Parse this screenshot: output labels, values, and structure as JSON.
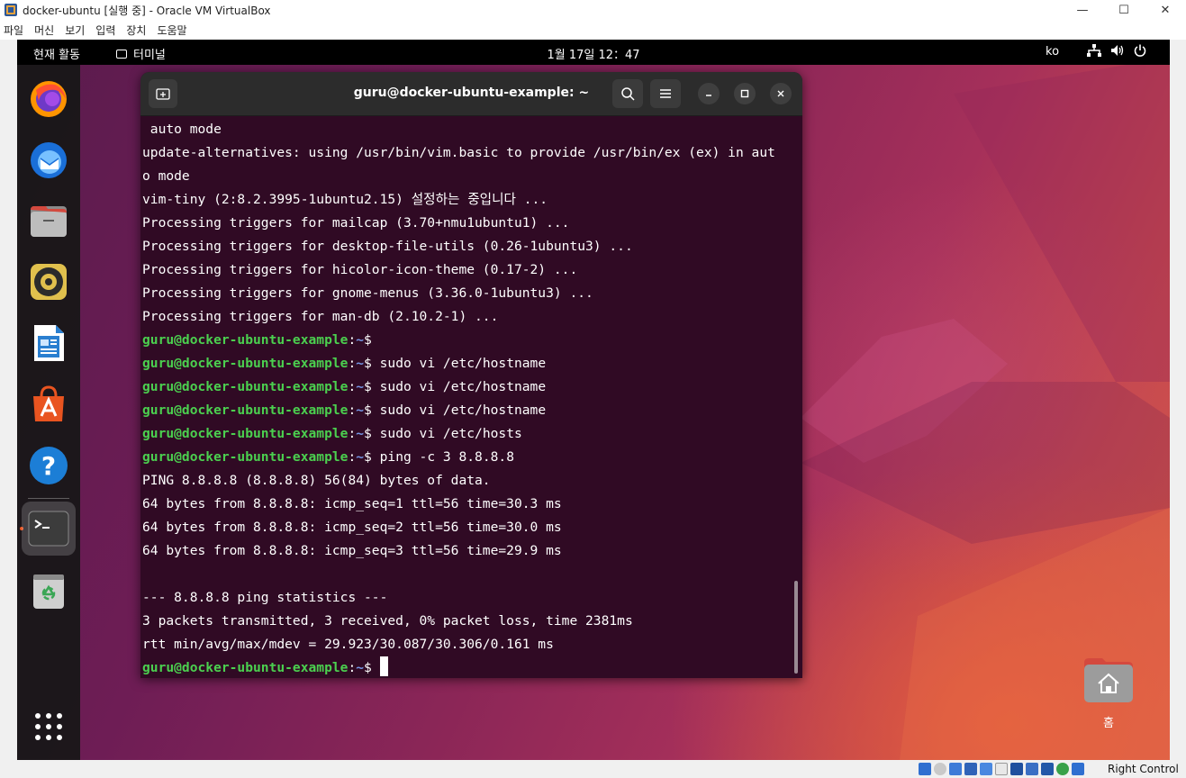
{
  "host": {
    "title": "docker-ubuntu [실행 중] - Oracle VM VirtualBox",
    "controls": [
      "—",
      "☐",
      "✕"
    ],
    "menu": [
      "파일",
      "머신",
      "보기",
      "입력",
      "장치",
      "도움말"
    ],
    "host_key": "Right Control"
  },
  "topbar": {
    "activities": "현재 활동",
    "app_name": "터미널",
    "clock": "1월 17일  12：47",
    "lang": "ko"
  },
  "dock": {
    "items": [
      "firefox-icon",
      "thunderbird-icon",
      "files-icon",
      "rhythmbox-icon",
      "libreoffice-writer-icon",
      "app-center-icon",
      "help-icon",
      "terminal-icon",
      "trash-icon",
      "show-apps-icon"
    ]
  },
  "terminal": {
    "title": "guru@docker-ubuntu-example: ~",
    "prompt_user": "guru@docker-ubuntu-example",
    "prompt_sep": ":",
    "prompt_path": "~",
    "prompt_end": "$ ",
    "lines": [
      " auto mode",
      "update-alternatives: using /usr/bin/vim.basic to provide /usr/bin/ex (ex) in aut",
      "o mode",
      "vim-tiny (2:8.2.3995-1ubuntu2.15) 설정하는 중입니다 ...",
      "Processing triggers for mailcap (3.70+nmu1ubuntu1) ...",
      "Processing triggers for desktop-file-utils (0.26-1ubuntu3) ...",
      "Processing triggers for hicolor-icon-theme (0.17-2) ...",
      "Processing triggers for gnome-menus (3.36.0-1ubuntu3) ...",
      "Processing triggers for man-db (2.10.2-1) ..."
    ],
    "commands": [
      "",
      "sudo vi /etc/hostname",
      "sudo vi /etc/hostname",
      "sudo vi /etc/hostname",
      "sudo vi /etc/hosts",
      "ping -c 3 8.8.8.8"
    ],
    "ping_output": [
      "PING 8.8.8.8 (8.8.8.8) 56(84) bytes of data.",
      "64 bytes from 8.8.8.8: icmp_seq=1 ttl=56 time=30.3 ms",
      "64 bytes from 8.8.8.8: icmp_seq=2 ttl=56 time=30.0 ms",
      "64 bytes from 8.8.8.8: icmp_seq=3 ttl=56 time=29.9 ms",
      "",
      "--- 8.8.8.8 ping statistics ---",
      "3 packets transmitted, 3 received, 0% packet loss, time 2381ms",
      "rtt min/avg/max/mdev = 29.923/30.087/30.306/0.161 ms"
    ],
    "colors": {
      "bg": "#300a24",
      "user": "#4bd04f",
      "path": "#7596e6"
    }
  },
  "desktop": {
    "home_label": "홈"
  }
}
